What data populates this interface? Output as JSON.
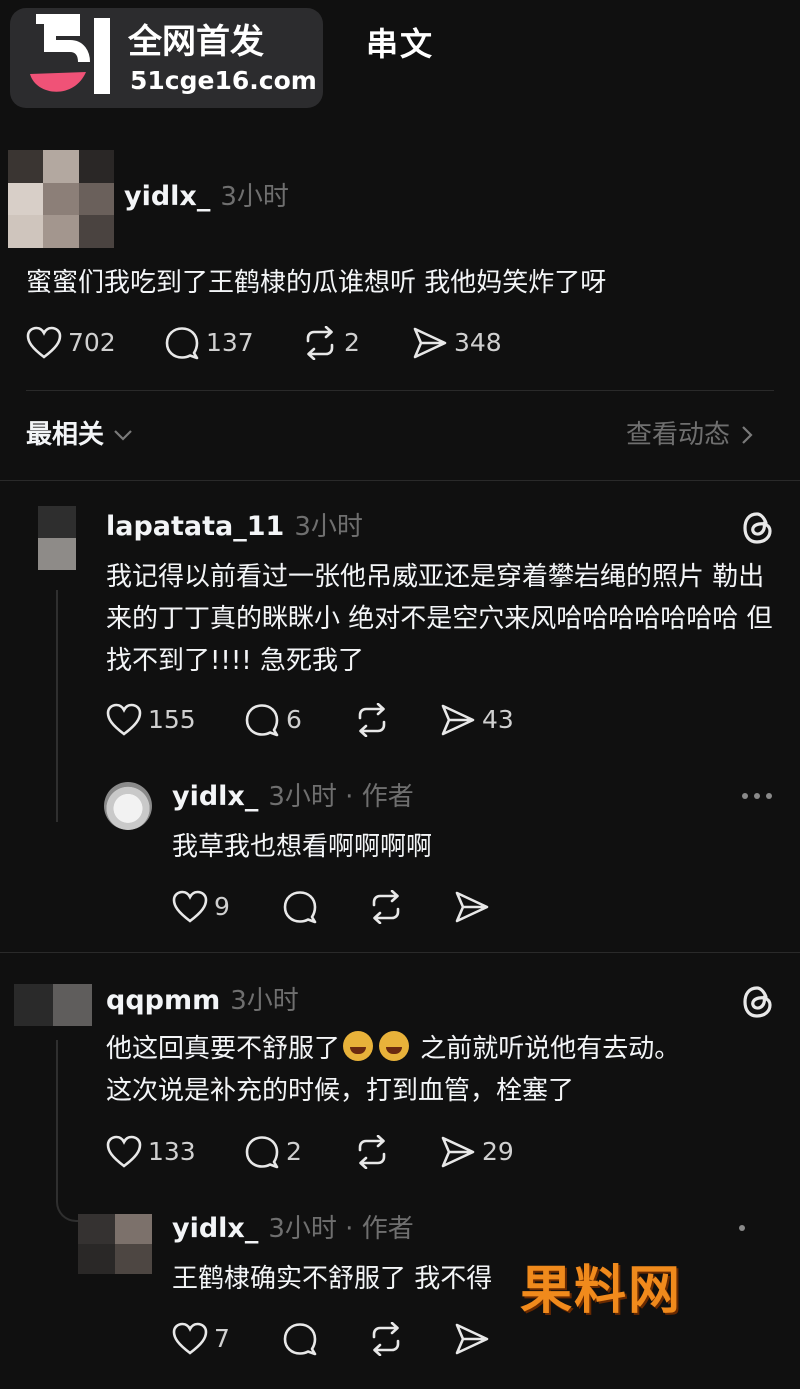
{
  "badge": {
    "logo_text": "51",
    "title": "全网首发",
    "url": "51cge16.com"
  },
  "header": {
    "title": "串文"
  },
  "post": {
    "username": "yidlx_",
    "time": "3小时",
    "text": "蜜蜜们我吃到了王鹤棣的瓜谁想听 我他妈笑炸了呀",
    "likes": "702",
    "comments": "137",
    "reposts": "2",
    "shares": "348"
  },
  "sort": {
    "label": "最相关",
    "view_activity": "查看动态"
  },
  "replies": [
    {
      "username": "lapatata_11",
      "time": "3小时",
      "text": "我记得以前看过一张他吊威亚还是穿着攀岩绳的照片 勒出来的丁丁真的眯眯小 绝对不是空穴来风哈哈哈哈哈哈哈 但找不到了!!!!  急死我了",
      "likes": "155",
      "comments": "6",
      "shares": "43",
      "sub_reply": {
        "username": "yidlx_",
        "meta": "3小时 · 作者",
        "text": "我草我也想看啊啊啊啊",
        "likes": "9"
      }
    },
    {
      "username": "qqpmm",
      "time": "3小时",
      "text_a": "他这回真要不舒服了",
      "text_b": " 之前就听说他有去动。",
      "text_c": "这次说是补充的时候，打到血管，栓塞了",
      "likes": "133",
      "comments": "2",
      "shares": "29",
      "sub_reply": {
        "username": "yidlx_",
        "meta": "3小时 · 作者",
        "text": "王鹤棣确实不舒服了 我不得",
        "likes": "7"
      }
    }
  ],
  "watermark": "果料网",
  "colors": {
    "background": "#101010",
    "text": "#f3f5f7",
    "muted": "#6f6f6f",
    "badge": "#2c2c2e",
    "watermark": "#f08a1c"
  }
}
